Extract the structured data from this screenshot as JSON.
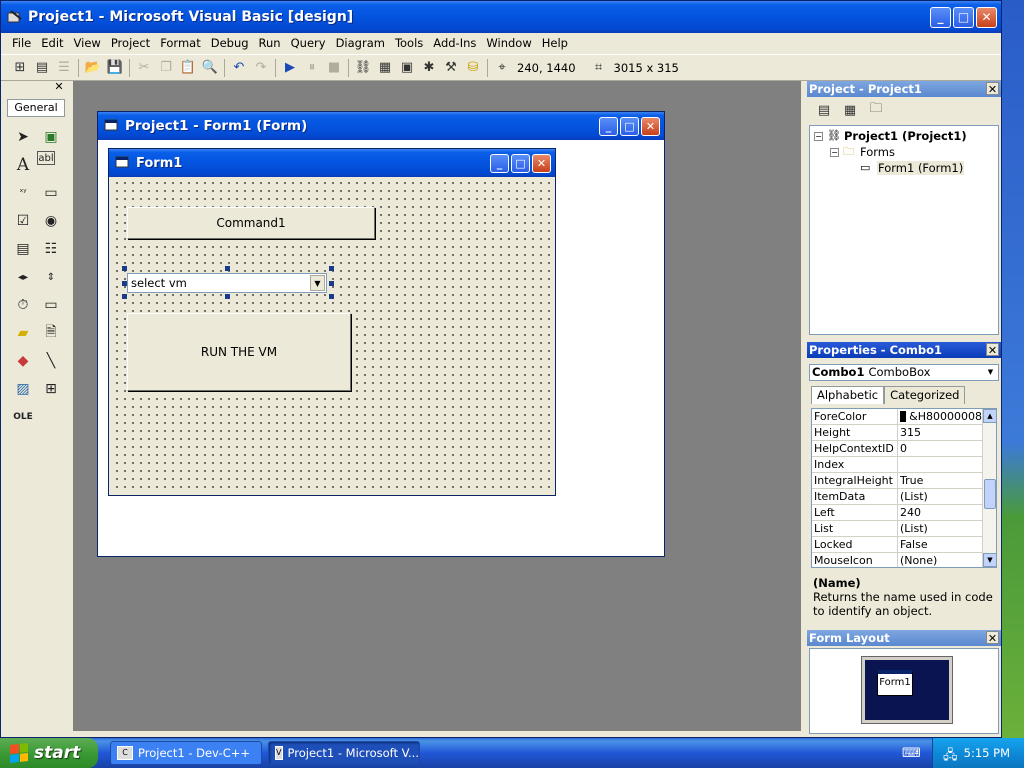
{
  "window": {
    "title": "Project1 - Microsoft Visual Basic [design]"
  },
  "menu": [
    "File",
    "Edit",
    "View",
    "Project",
    "Format",
    "Debug",
    "Run",
    "Query",
    "Diagram",
    "Tools",
    "Add-Ins",
    "Window",
    "Help"
  ],
  "toolbar": {
    "position": "240, 1440",
    "size": "3015 x 315"
  },
  "toolbox": {
    "tab": "General"
  },
  "form_window": {
    "title": "Project1 - Form1 (Form)"
  },
  "form1": {
    "title": "Form1",
    "command1_label": "Command1",
    "combo_text": "select vm",
    "run_button_label": "RUN THE VM"
  },
  "project_panel": {
    "title": "Project - Project1",
    "tree": {
      "root": "Project1 (Project1)",
      "folder": "Forms",
      "item": "Form1 (Form1)"
    }
  },
  "properties_panel": {
    "title": "Properties - Combo1",
    "object_name": "Combo1",
    "object_type": "ComboBox",
    "tabs": [
      "Alphabetic",
      "Categorized"
    ],
    "rows": [
      {
        "name": "ForeColor",
        "value": "&H80000008"
      },
      {
        "name": "Height",
        "value": "315"
      },
      {
        "name": "HelpContextID",
        "value": "0"
      },
      {
        "name": "Index",
        "value": ""
      },
      {
        "name": "IntegralHeight",
        "value": "True"
      },
      {
        "name": "ItemData",
        "value": "(List)"
      },
      {
        "name": "Left",
        "value": "240"
      },
      {
        "name": "List",
        "value": "(List)"
      },
      {
        "name": "Locked",
        "value": "False"
      },
      {
        "name": "MouseIcon",
        "value": "(None)"
      }
    ],
    "desc_title": "(Name)",
    "desc_text": "Returns the name used in code to identify an object."
  },
  "layout_panel": {
    "title": "Form Layout",
    "mini_form": "Form1"
  },
  "taskbar": {
    "start": "start",
    "tasks": [
      "Project1 - Dev-C++",
      "Project1 - Microsoft V..."
    ],
    "clock": "5:15 PM"
  }
}
